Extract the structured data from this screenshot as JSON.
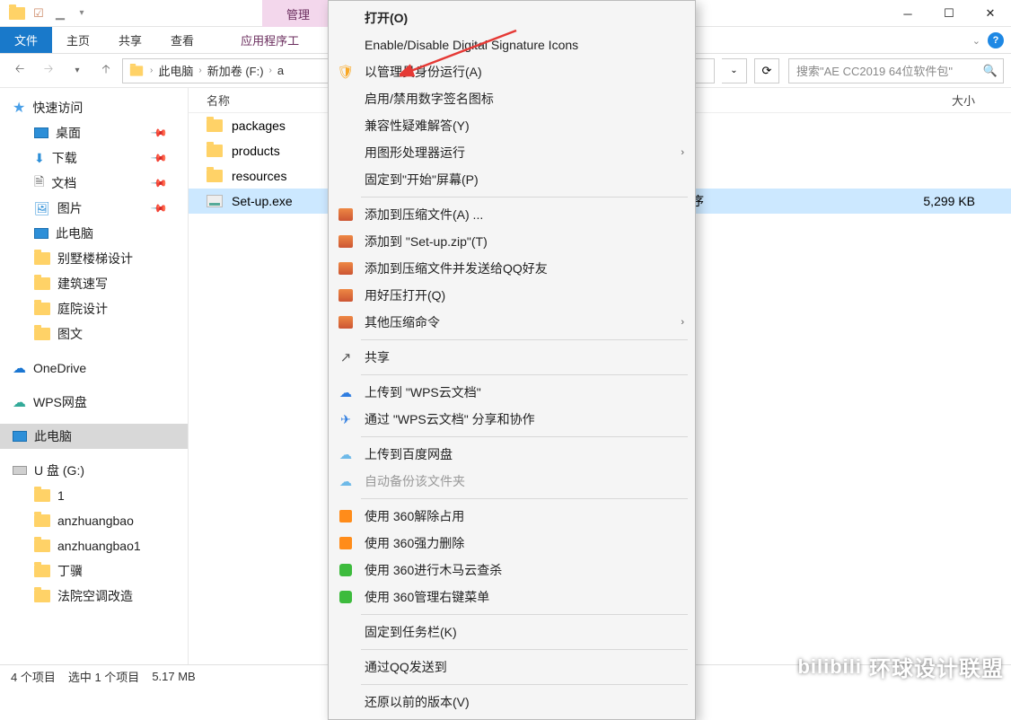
{
  "titlebar": {
    "context_tab": "管理"
  },
  "ribbon": {
    "tabs": {
      "file": "文件",
      "home": "主页",
      "share": "共享",
      "view": "查看",
      "apptools": "应用程序工"
    }
  },
  "navbar": {
    "crumbs": {
      "this_pc": "此电脑",
      "volume": "新加卷 (F:)",
      "partial": "a"
    },
    "search_placeholder": "搜索\"AE CC2019 64位软件包\""
  },
  "columns": {
    "name": "名称",
    "size": "大小"
  },
  "files": [
    {
      "name": "packages",
      "type": "folder"
    },
    {
      "name": "products",
      "type": "folder"
    },
    {
      "name": "resources",
      "type": "folder"
    },
    {
      "name": "Set-up.exe",
      "type": "exe",
      "size": "5,299 KB",
      "selected": true
    }
  ],
  "file_row_type_trailing": "序",
  "sidebar": {
    "quick_access": "快速访问",
    "desktop": "桌面",
    "downloads": "下载",
    "documents": "文档",
    "pictures": "图片",
    "this_pc_q": "此电脑",
    "f1": "别墅楼梯设计",
    "f2": "建筑速写",
    "f3": "庭院设计",
    "f4": "图文",
    "onedrive": "OneDrive",
    "wps": "WPS网盘",
    "this_pc": "此电脑",
    "udisk": "U 盘 (G:)",
    "g1": "1",
    "g2": "anzhuangbao",
    "g3": "anzhuangbao1",
    "g4": "丁骥",
    "g5": "法院空调改造"
  },
  "context_menu": {
    "open": "打开(O)",
    "enable_sig": "Enable/Disable Digital Signature Icons",
    "run_admin": "以管理员身份运行(A)",
    "enable_sig_icon": "启用/禁用数字签名图标",
    "compat": "兼容性疑难解答(Y)",
    "gpu": "用图形处理器运行",
    "pin_start": "固定到\"开始\"屏幕(P)",
    "add_archive": "添加到压缩文件(A) ...",
    "add_zip": "添加到 \"Set-up.zip\"(T)",
    "add_qq": "添加到压缩文件并发送给QQ好友",
    "open_haozip": "用好压打开(Q)",
    "other_compress": "其他压缩命令",
    "share": "共享",
    "wps_upload": "上传到 \"WPS云文档\"",
    "wps_share": "通过 \"WPS云文档\" 分享和协作",
    "baidu_upload": "上传到百度网盘",
    "baidu_auto": "自动备份该文件夹",
    "s360_unlock": "使用 360解除占用",
    "s360_delete": "使用 360强力删除",
    "s360_scan": "使用 360进行木马云查杀",
    "s360_menu": "使用 360管理右键菜单",
    "pin_taskbar": "固定到任务栏(K)",
    "send_qq": "通过QQ发送到",
    "restore_prev": "还原以前的版本(V)"
  },
  "statusbar": {
    "items": "4 个项目",
    "selected": "选中 1 个项目",
    "size": "5.17 MB"
  },
  "watermark": "环球设计联盟"
}
